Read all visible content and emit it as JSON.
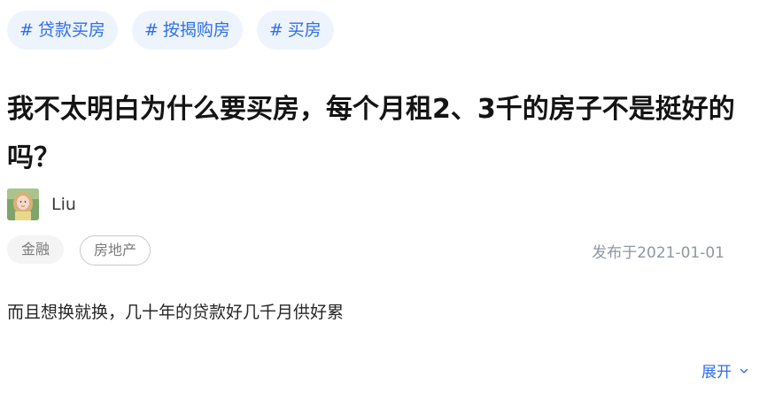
{
  "topics": [
    {
      "hash": "#",
      "label": "贷款买房"
    },
    {
      "hash": "#",
      "label": "按揭购房"
    },
    {
      "hash": "#",
      "label": "买房"
    }
  ],
  "question": {
    "title": "我不太明白为什么要买房，每个月租2、3千的房子不是挺好的吗？",
    "author": "Liu",
    "tags": [
      "金融",
      "房地产"
    ],
    "publish_time": "发布于2021-01-01",
    "body": "而且想换就换，几十年的贷款好几千月供好累",
    "expand_label": "展开"
  },
  "colors": {
    "accent": "#2f6fe8",
    "pill_bg": "#eef4fd",
    "muted": "#8f96a3"
  },
  "icons": {
    "avatar": "user-avatar",
    "expand": "chevron-down-icon"
  }
}
